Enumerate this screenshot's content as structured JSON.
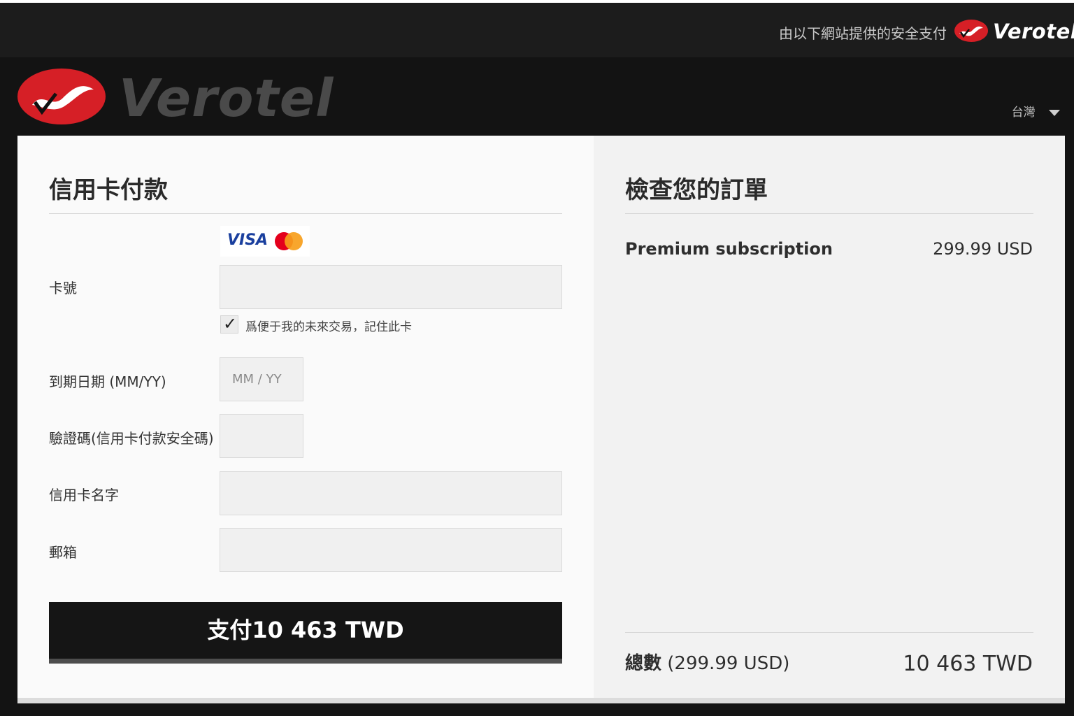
{
  "topbar": {
    "secure_text": "由以下網站提供的安全支付",
    "logo_word": "Verotel"
  },
  "header": {
    "logo_word": "Verotel",
    "language": "台灣"
  },
  "payment": {
    "title": "信用卡付款",
    "card_brands": [
      "VISA",
      "Mastercard"
    ],
    "card_number_label": "卡號",
    "remember_label": "爲便于我的未來交易，記住此卡",
    "remember_checked": true,
    "expiry_label": "到期日期 (MM/YY)",
    "expiry_placeholder": "MM / YY",
    "cvv_label": "驗證碼(信用卡付款安全碼)",
    "name_label": "信用卡名字",
    "email_label": "郵箱",
    "pay_button": "支付10 463 TWD"
  },
  "order": {
    "title": "檢查您的訂單",
    "item_name": "Premium subscription",
    "item_price": "299.99 USD",
    "total_label": "總數",
    "total_usd": "(299.99 USD)",
    "total_twd": "10 463 TWD"
  },
  "colors": {
    "brand_red": "#d61f26",
    "dark_bg": "#131313",
    "field_bg": "#f0f0f0",
    "button_bg": "#151515"
  }
}
